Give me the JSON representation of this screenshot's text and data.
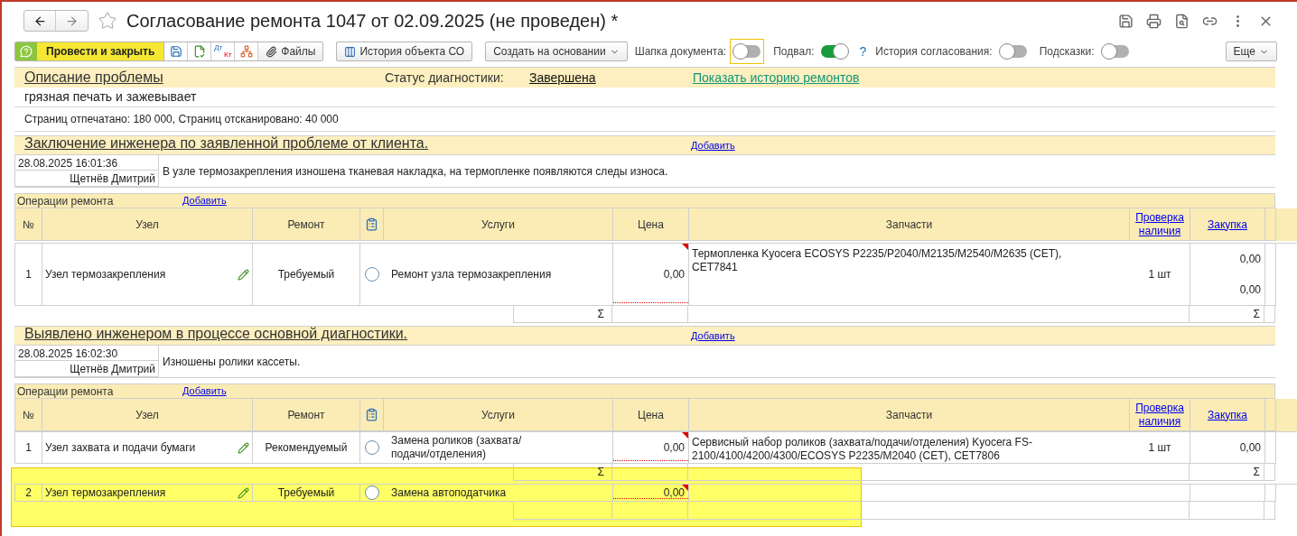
{
  "window": {
    "title": "Согласование ремонта 1047 от 02.09.2025 (не проведен) *"
  },
  "toolbar": {
    "primary": "Провести и закрыть",
    "journal": {
      "top": "Дт",
      "bottom": "Кт"
    },
    "files": "Файлы",
    "history": "История объекта СО",
    "create": "Создать на основании",
    "toggles": [
      {
        "label": "Шапка документа:",
        "on": false,
        "focused": true
      },
      {
        "label": "Подвал:",
        "on": true,
        "focused": false,
        "help": "?"
      },
      {
        "label": "История согласования:",
        "on": false,
        "focused": false
      },
      {
        "label": "Подсказки:",
        "on": false,
        "focused": false
      }
    ],
    "more": "Еще"
  },
  "problem": {
    "title": "Описание проблемы",
    "status_label": "Статус диагностики:",
    "status_value": "Завершена",
    "history_link": "Показать историю ремонтов",
    "text": "грязная печать и зажевывает",
    "stats": "Страниц отпечатано: 180 000, Страниц отсканировано: 40 000"
  },
  "sections": [
    {
      "title": "Заключение инженера по заявленной проблеме от клиента.",
      "add": "Добавить",
      "entry": {
        "datetime": "28.08.2025 16:01:36",
        "author": "Щетнёв Дмитрий",
        "text": "В узле термозакрепления изношена тканевая накладка, на термопленке появляются следы износа."
      },
      "operations": {
        "title": "Операции ремонта",
        "add": "Добавить",
        "columns": [
          "№",
          "Узел",
          "Ремонт",
          "Услуги",
          "Цена",
          "Запчасти",
          "Проверка наличия",
          "Закупка"
        ],
        "lines": [
          {
            "kind": "row",
            "num": "1",
            "node": "Узел термозакрепления",
            "repair": "Требуемый",
            "checked": false,
            "service": "Ремонт узла термозакрепления",
            "price": "0,00",
            "parts": "Термопленка Kyocera ECOSYS P2235/P2040/M2135/M2540/M2635 (CET), CET7841",
            "qty": "1 шт",
            "purchase": [
              "0,00",
              "0,00"
            ]
          },
          {
            "kind": "total",
            "service_total": "Σ",
            "purchase_total": "Σ"
          }
        ]
      }
    },
    {
      "title": "Выявлено инженером в процессе основной диагностики.",
      "add": "Добавить",
      "entry": {
        "datetime": "28.08.2025 16:02:30",
        "author": "Щетнёв Дмитрий",
        "text": "Изношены ролики кассеты."
      },
      "operations": {
        "title": "Операции ремонта",
        "add": "Добавить",
        "columns": [
          "№",
          "Узел",
          "Ремонт",
          "Услуги",
          "Цена",
          "Запчасти",
          "Проверка наличия",
          "Закупка"
        ],
        "lines": [
          {
            "kind": "row",
            "num": "1",
            "node": "Узел захвата и подачи бумаги",
            "repair": "Рекомендуемый",
            "checked": false,
            "service": "Замена роликов (захвата/подачи/отделения)",
            "price": "0,00",
            "parts": "Сервисный набор роликов (захвата/подачи/отделения) Kyocera FS-2100/4100/4200/4300/ECOSYS P2235/M2040 (CET), CET7806",
            "qty": "1 шт",
            "purchase": [
              "0,00"
            ]
          },
          {
            "kind": "total",
            "service_total": "Σ",
            "purchase_total": "Σ"
          },
          {
            "kind": "row",
            "num": "2",
            "node": "Узел термозакрепления",
            "repair": "Требуемый",
            "checked": false,
            "service": "Замена автоподатчика",
            "price": "0,00"
          },
          {
            "kind": "blank"
          }
        ]
      }
    }
  ]
}
